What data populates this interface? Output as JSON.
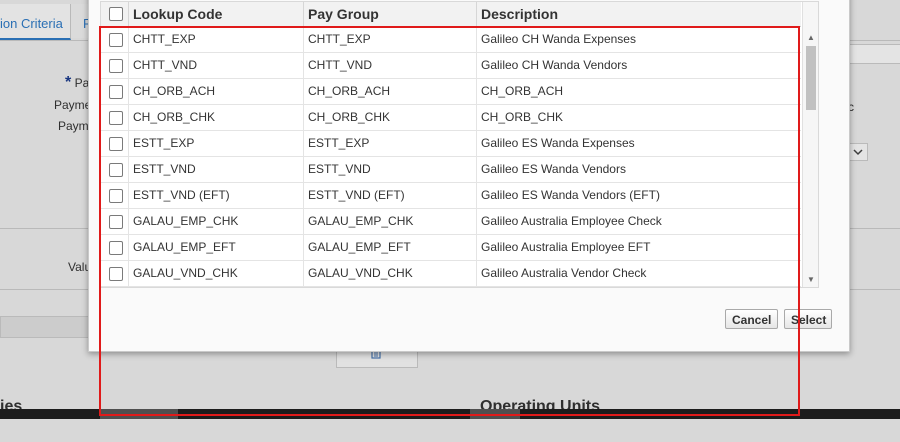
{
  "background": {
    "tab_active": "ion Criteria",
    "tab_next": "F",
    "labels": {
      "required_mark": "*",
      "p_label": "Pa",
      "payment_label_1": "Payme",
      "payment_label_2": "Paym",
      "value_label": "Valu",
      "right_fragment": "c"
    },
    "headings": {
      "left": "ies",
      "operating_units": "Operating Units"
    }
  },
  "dialog": {
    "columns": [
      "Lookup Code",
      "Pay Group",
      "Description"
    ],
    "rows": [
      {
        "lookup_code": "CHTT_EXP",
        "pay_group": "CHTT_EXP",
        "description": "Galileo CH Wanda Expenses"
      },
      {
        "lookup_code": "CHTT_VND",
        "pay_group": "CHTT_VND",
        "description": "Galileo CH Wanda Vendors"
      },
      {
        "lookup_code": "CH_ORB_ACH",
        "pay_group": "CH_ORB_ACH",
        "description": "CH_ORB_ACH"
      },
      {
        "lookup_code": "CH_ORB_CHK",
        "pay_group": "CH_ORB_CHK",
        "description": "CH_ORB_CHK"
      },
      {
        "lookup_code": "ESTT_EXP",
        "pay_group": "ESTT_EXP",
        "description": "Galileo ES Wanda Expenses"
      },
      {
        "lookup_code": "ESTT_VND",
        "pay_group": "ESTT_VND",
        "description": "Galileo ES Wanda Vendors"
      },
      {
        "lookup_code": "ESTT_VND (EFT)",
        "pay_group": "ESTT_VND (EFT)",
        "description": "Galileo ES Wanda Vendors (EFT)"
      },
      {
        "lookup_code": "GALAU_EMP_CHK",
        "pay_group": "GALAU_EMP_CHK",
        "description": "Galileo Australia Employee Check"
      },
      {
        "lookup_code": "GALAU_EMP_EFT",
        "pay_group": "GALAU_EMP_EFT",
        "description": "Galileo Australia Employee EFT"
      },
      {
        "lookup_code": "GALAU_VND_CHK",
        "pay_group": "GALAU_VND_CHK",
        "description": "Galileo Australia Vendor Check"
      }
    ],
    "buttons": {
      "cancel": "Cancel",
      "select": "Select"
    }
  },
  "colors": {
    "highlight_border": "#e01a1a",
    "tab_accent": "#2e78c2"
  }
}
